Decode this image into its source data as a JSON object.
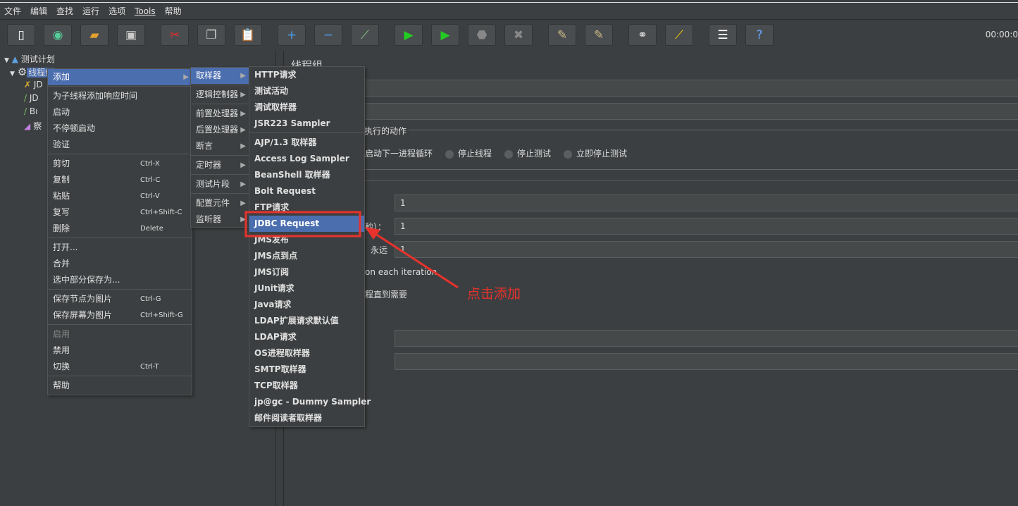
{
  "menubar": [
    "文件",
    "编辑",
    "查找",
    "运行",
    "选项",
    "Tools",
    "帮助"
  ],
  "toolbar": {
    "icons": [
      "new-icon",
      "templates-icon",
      "open-icon",
      "save-icon",
      "cut-icon",
      "copy-icon",
      "paste-icon",
      "expand-icon",
      "collapse-icon",
      "toggle-icon",
      "start-icon",
      "start-no-pause-icon",
      "stop-icon",
      "shutdown-icon",
      "clear-icon",
      "clear-all-icon",
      "search-icon",
      "reset-search-icon",
      "function-helper-icon",
      "help-icon"
    ],
    "timer": "00:00:0"
  },
  "tree": {
    "root": "测试计划",
    "thread_group": "线程组",
    "children": [
      "JD",
      "JD",
      "Bı",
      "察"
    ]
  },
  "panel": {
    "title": "线程组",
    "action_group": "执行的动作",
    "radios": [
      "启动下一进程循环",
      "停止线程",
      "停止测试",
      "立即停止测试"
    ],
    "threads_value": "1",
    "rampup_label": "秒）：",
    "rampup_value": "1",
    "loop_forever": "永远",
    "loop_value": "1",
    "same_user": "on each iteration",
    "delay": "程直到需要"
  },
  "context_menu": {
    "items": [
      {
        "label": "添加",
        "highlight": true,
        "submenu": true
      },
      {
        "sep": true
      },
      {
        "label": "为子线程添加响应时间"
      },
      {
        "label": "启动"
      },
      {
        "label": "不停顿启动"
      },
      {
        "label": "验证"
      },
      {
        "sep": true
      },
      {
        "label": "剪切",
        "shortcut": "Ctrl-X"
      },
      {
        "label": "复制",
        "shortcut": "Ctrl-C"
      },
      {
        "label": "粘贴",
        "shortcut": "Ctrl-V"
      },
      {
        "label": "复写",
        "shortcut": "Ctrl+Shift-C"
      },
      {
        "label": "删除",
        "shortcut": "Delete"
      },
      {
        "sep": true
      },
      {
        "label": "打开..."
      },
      {
        "label": "合并"
      },
      {
        "label": "选中部分保存为..."
      },
      {
        "sep": true
      },
      {
        "label": "保存节点为图片",
        "shortcut": "Ctrl-G"
      },
      {
        "label": "保存屏幕为图片",
        "shortcut": "Ctrl+Shift-G"
      },
      {
        "sep": true
      },
      {
        "label": "启用",
        "disabled": true
      },
      {
        "label": "禁用"
      },
      {
        "label": "切换",
        "shortcut": "Ctrl-T"
      },
      {
        "sep": true
      },
      {
        "label": "帮助"
      }
    ]
  },
  "add_menu": {
    "items": [
      {
        "label": "取样器",
        "highlight": true
      },
      {
        "sep": true
      },
      {
        "label": "逻辑控制器"
      },
      {
        "sep": true
      },
      {
        "label": "前置处理器"
      },
      {
        "label": "后置处理器"
      },
      {
        "label": "断言"
      },
      {
        "sep": true
      },
      {
        "label": "定时器"
      },
      {
        "sep": true
      },
      {
        "label": "测试片段"
      },
      {
        "sep": true
      },
      {
        "label": "配置元件"
      },
      {
        "label": "监听器"
      }
    ]
  },
  "sampler_menu": {
    "items": [
      {
        "label": "HTTP请求"
      },
      {
        "label": "测试活动"
      },
      {
        "label": "调试取样器"
      },
      {
        "label": "JSR223 Sampler"
      },
      {
        "sep": true
      },
      {
        "label": "AJP/1.3 取样器"
      },
      {
        "label": "Access Log Sampler"
      },
      {
        "label": "BeanShell 取样器"
      },
      {
        "label": "Bolt Request"
      },
      {
        "label": "FTP请求"
      },
      {
        "label": "JDBC Request",
        "highlight": true
      },
      {
        "label": "JMS发布"
      },
      {
        "label": "JMS点到点"
      },
      {
        "label": "JMS订阅"
      },
      {
        "label": "JUnit请求"
      },
      {
        "label": "Java请求"
      },
      {
        "label": "LDAP扩展请求默认值"
      },
      {
        "label": "LDAP请求"
      },
      {
        "label": "OS进程取样器"
      },
      {
        "label": "SMTP取样器"
      },
      {
        "label": "TCP取样器"
      },
      {
        "label": "jp@gc - Dummy Sampler"
      },
      {
        "label": "邮件阅读者取样器"
      }
    ]
  },
  "annotation": {
    "text": "点击添加",
    "color": "#e8322c"
  },
  "colors": {
    "highlight": "#4b6eaf",
    "background": "#3c3f41"
  }
}
